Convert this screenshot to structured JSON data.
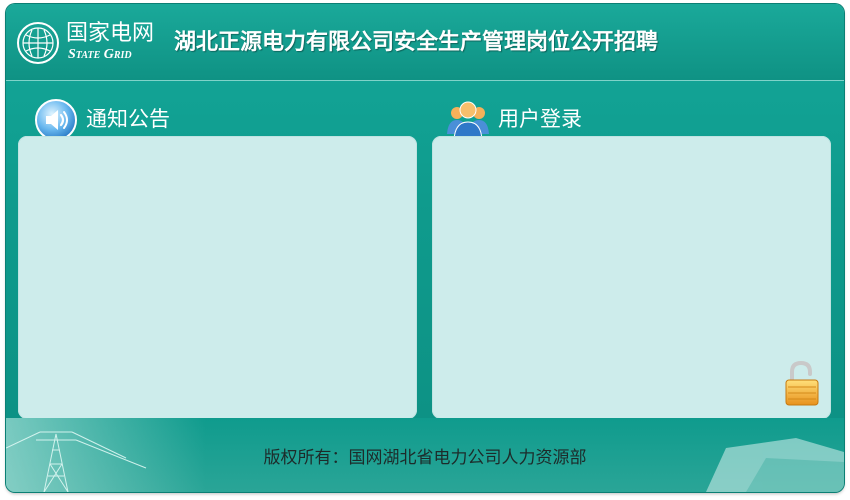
{
  "header": {
    "logo_cn": "国家电网",
    "logo_en": "State Grid",
    "site_title": "湖北正源电力有限公司安全生产管理岗位公开招聘"
  },
  "notice": {
    "title": "通知公告",
    "icon": "speaker-icon"
  },
  "login": {
    "title": "用户登录",
    "icon": "users-icon",
    "lock_icon": "lock-icon"
  },
  "footer": {
    "copyright": "版权所有：国网湖北省电力公司人力资源部"
  },
  "colors": {
    "primary": "#0f9b8d",
    "panel_bg": "#cdeceb",
    "header_title": "#ffffff"
  }
}
